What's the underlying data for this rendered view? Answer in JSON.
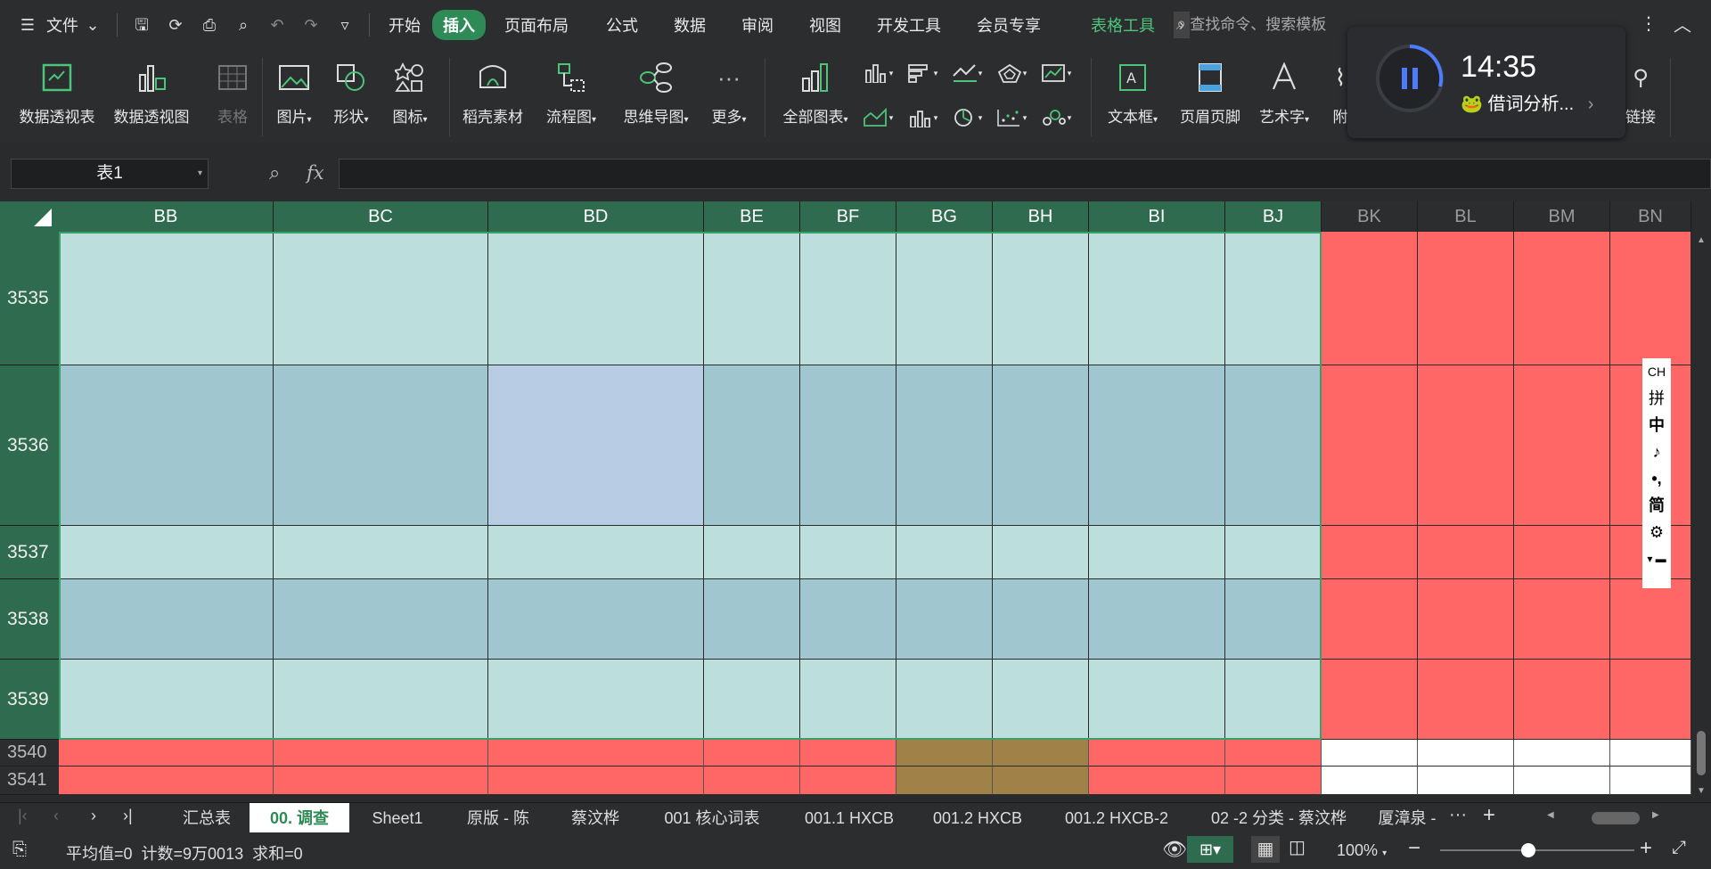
{
  "menu": {
    "file_label": "文件",
    "tabs": [
      "开始",
      "插入",
      "页面布局",
      "公式",
      "数据",
      "审阅",
      "视图",
      "开发工具",
      "会员专享",
      "表格工具"
    ],
    "active_tab": "插入",
    "search_placeholder": "查找命令、搜索模板"
  },
  "ribbon": {
    "pivot_table": "数据透视表",
    "pivot_chart": "数据透视图",
    "table": "表格",
    "picture": "图片",
    "shape": "形状",
    "icon": "图标",
    "straw_material": "稻壳素材",
    "flowchart": "流程图",
    "mindmap": "思维导图",
    "more": "更多",
    "all_charts": "全部图表",
    "textbox": "文本框",
    "header_footer": "页眉页脚",
    "wordart": "艺术字",
    "attach": "附",
    "link": "链接"
  },
  "formula_bar": {
    "name_box": "表1",
    "fx": "fx",
    "value": ""
  },
  "columns": {
    "selected": [
      "BB",
      "BC",
      "BD",
      "BE",
      "BF",
      "BG",
      "BH",
      "BI",
      "BJ"
    ],
    "unselected": [
      "BK",
      "BL",
      "BM",
      "BN"
    ]
  },
  "rows": [
    "3535",
    "3536",
    "3537",
    "3538",
    "3539",
    "3540",
    "3541"
  ],
  "sheet_tabs": [
    "汇总表",
    "00. 调查",
    "Sheet1",
    "原版 - 陈",
    "蔡汶桦",
    "001 核心词表",
    "001.1 HXCB",
    "001.2 HXCB",
    "001.2 HXCB-2",
    "02 -2 分类 - 蔡汶桦",
    "厦漳泉 -"
  ],
  "active_sheet": "00. 调查",
  "status": {
    "summary": "平均值=0  计数=9万0013  求和=0",
    "zoom": "100%"
  },
  "timer": {
    "time": "14:35",
    "label": "借词分析..."
  },
  "ime": {
    "items": [
      "CH",
      "拼",
      "中",
      "♪",
      "•,",
      "简",
      "⚙"
    ]
  },
  "colors": {
    "header_green": "#2f6b4f",
    "cell_teal": "#bcdedc",
    "cell_blue": "#a0c6d0",
    "cell_lavender": "#b8cce4",
    "cell_red": "#ff6666",
    "cell_brown": "#a08148",
    "accent": "#2e8b57"
  }
}
